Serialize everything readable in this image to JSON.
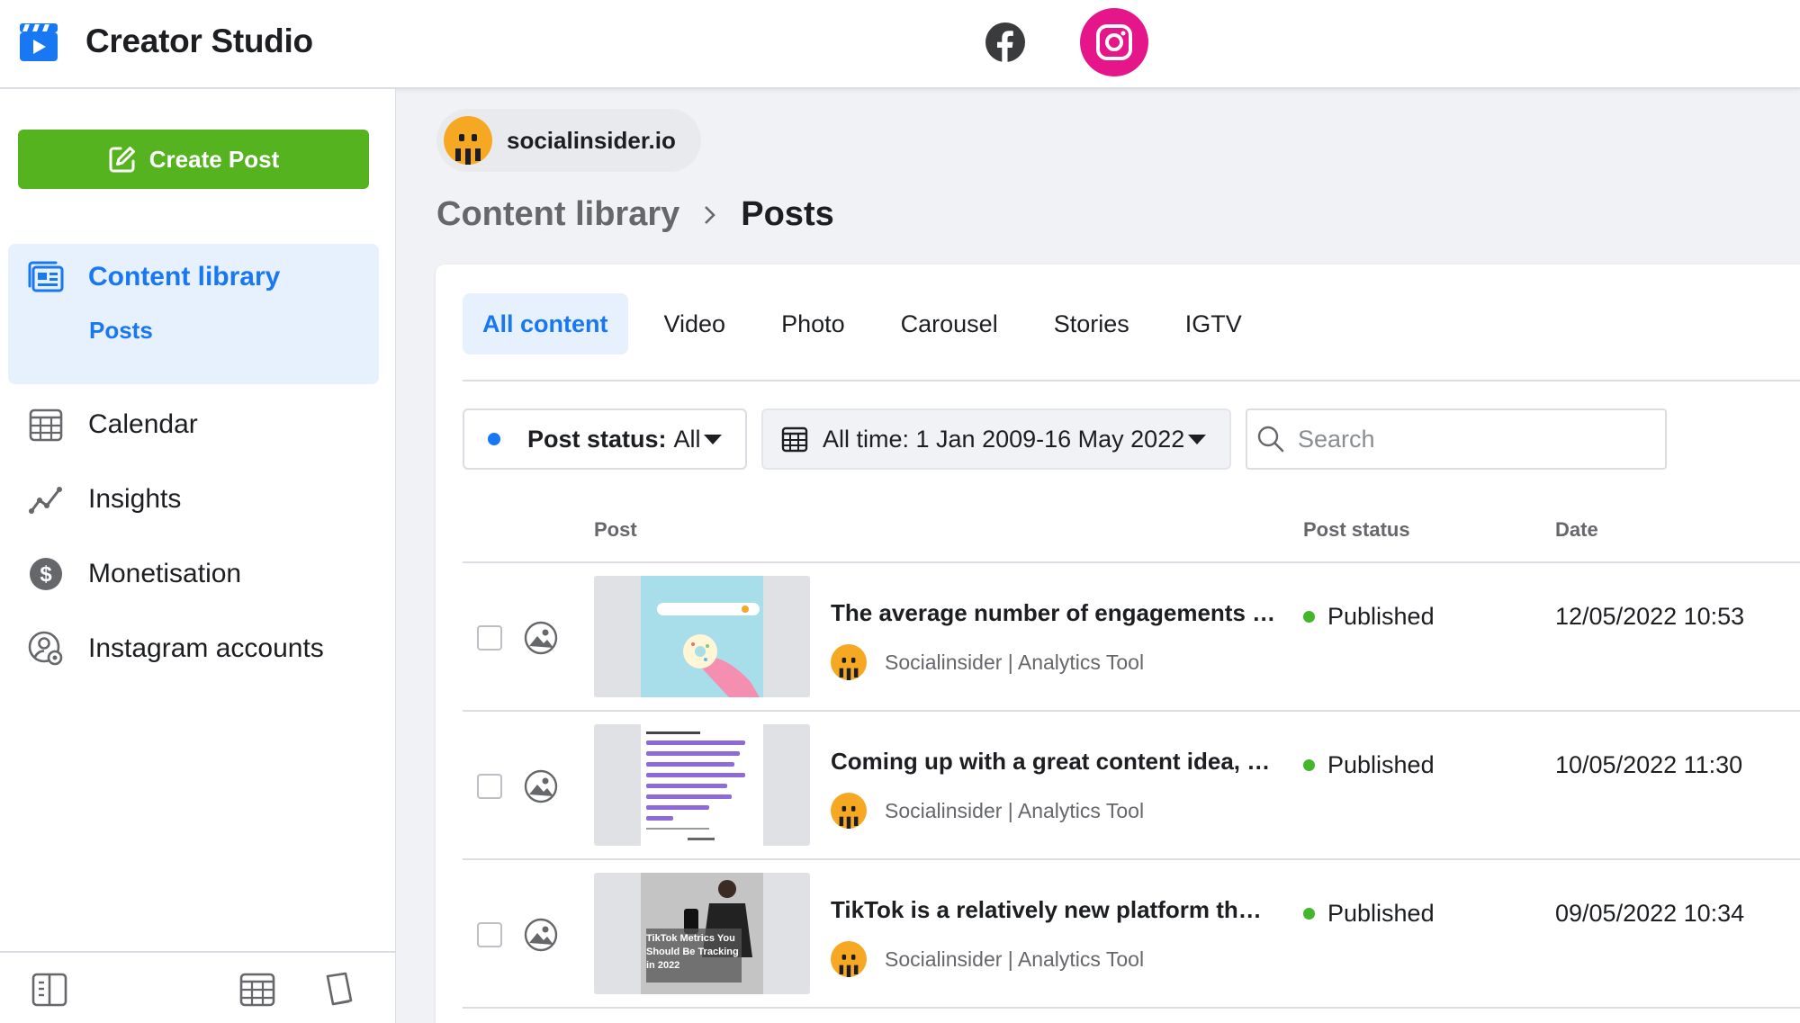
{
  "app": {
    "title": "Creator Studio"
  },
  "sidebar": {
    "create_post_label": "Create Post",
    "items": [
      {
        "label": "Content library",
        "icon": "content-library-icon",
        "active": true
      },
      {
        "label": "Calendar",
        "icon": "calendar-icon"
      },
      {
        "label": "Insights",
        "icon": "insights-icon"
      },
      {
        "label": "Monetisation",
        "icon": "monetisation-icon"
      },
      {
        "label": "Instagram accounts",
        "icon": "instagram-accounts-icon"
      }
    ],
    "subitem": "Posts"
  },
  "account": {
    "name": "socialinsider.io"
  },
  "breadcrumb": {
    "parent": "Content library",
    "current": "Posts"
  },
  "tabs": [
    "All content",
    "Video",
    "Photo",
    "Carousel",
    "Stories",
    "IGTV"
  ],
  "filters": {
    "status_label": "Post status:",
    "status_value": "All",
    "date_label": "All time: 1 Jan 2009-16 May 2022",
    "search_placeholder": "Search"
  },
  "table": {
    "columns": [
      "Post",
      "Post status",
      "Date"
    ],
    "rows": [
      {
        "title": "The average number of engagements …",
        "author": "Socialinsider | Analytics Tool",
        "status": "Published",
        "date": "12/05/2022 10:53",
        "thumb": "donut"
      },
      {
        "title": "Coming up with a great content idea, …",
        "author": "Socialinsider | Analytics Tool",
        "status": "Published",
        "date": "10/05/2022 11:30",
        "thumb": "bars"
      },
      {
        "title": "TikTok is a relatively new platform th…",
        "author": "Socialinsider | Analytics Tool",
        "status": "Published",
        "date": "09/05/2022 10:34",
        "thumb": "tiktok",
        "thumb_caption": "TikTok Metrics You Should Be Tracking in 2022"
      }
    ]
  },
  "colors": {
    "accent": "#1877f2",
    "create": "#54b31e",
    "instagram": "#e4168a",
    "published": "#42b72a"
  }
}
